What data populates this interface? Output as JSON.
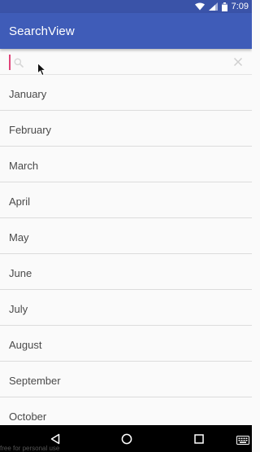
{
  "status_bar": {
    "time": "7:09",
    "icons": [
      "wifi-icon",
      "signal-icon",
      "battery-icon"
    ]
  },
  "app_bar": {
    "title": "SearchView"
  },
  "search": {
    "value": "",
    "placeholder": "",
    "icon": "search-icon",
    "clear_icon": "close-icon"
  },
  "months": [
    "January",
    "February",
    "March",
    "April",
    "May",
    "June",
    "July",
    "August",
    "September",
    "October"
  ],
  "nav_bar": {
    "buttons": [
      "back-icon",
      "home-icon",
      "recents-icon",
      "keyboard-icon"
    ]
  },
  "watermark": "free for personal use",
  "colors": {
    "status_bar": "#3a53a8",
    "app_bar": "#3f5cb8",
    "cursor": "#e0447a",
    "background": "#fafafa",
    "divider": "#dcdcdc",
    "text": "#4a4a4a"
  }
}
